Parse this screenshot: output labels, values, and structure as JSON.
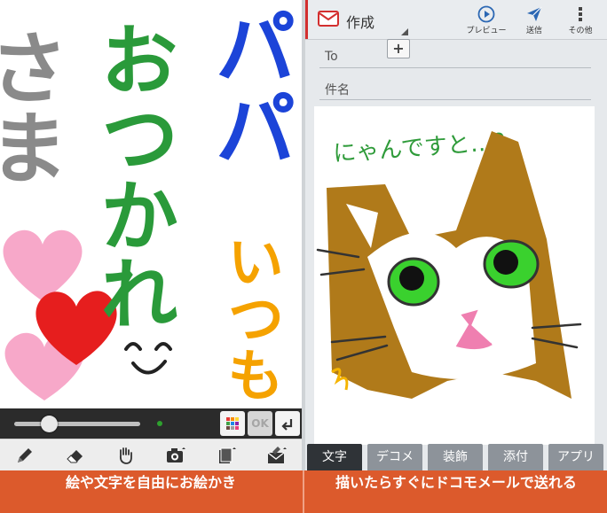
{
  "left_panel": {
    "drawn_text": {
      "sama": "さま",
      "otsukare": "おつかれ",
      "papa": "パパ",
      "itsumo": "いつも"
    },
    "ok_label": "OK",
    "tools": [
      {
        "icon": "pencil-icon"
      },
      {
        "icon": "eraser-icon"
      },
      {
        "icon": "hand-icon"
      },
      {
        "icon": "camera-icon"
      },
      {
        "icon": "stamp-icon"
      },
      {
        "icon": "mail-insert-icon"
      }
    ],
    "pen_color": "#2ea12e"
  },
  "right_panel": {
    "title": "作成",
    "actions": {
      "preview": "プレビュー",
      "send": "送信",
      "more": "その他"
    },
    "to_label": "To",
    "subject_placeholder": "件名",
    "drawing_text": {
      "line1": "にゃんですと…?"
    },
    "deco_tabs": [
      "文字",
      "デコメ",
      "装飾",
      "添付",
      "アプリ"
    ]
  },
  "captions": {
    "left": "絵や文字を自由にお絵かき",
    "right": "描いたらすぐにドコモメールで送れる"
  },
  "colors": {
    "caption_bg": "#dc5a2c",
    "accent_red": "#d32f2f",
    "tab_active": "#2f3337",
    "tab_inactive": "#8d939a"
  }
}
